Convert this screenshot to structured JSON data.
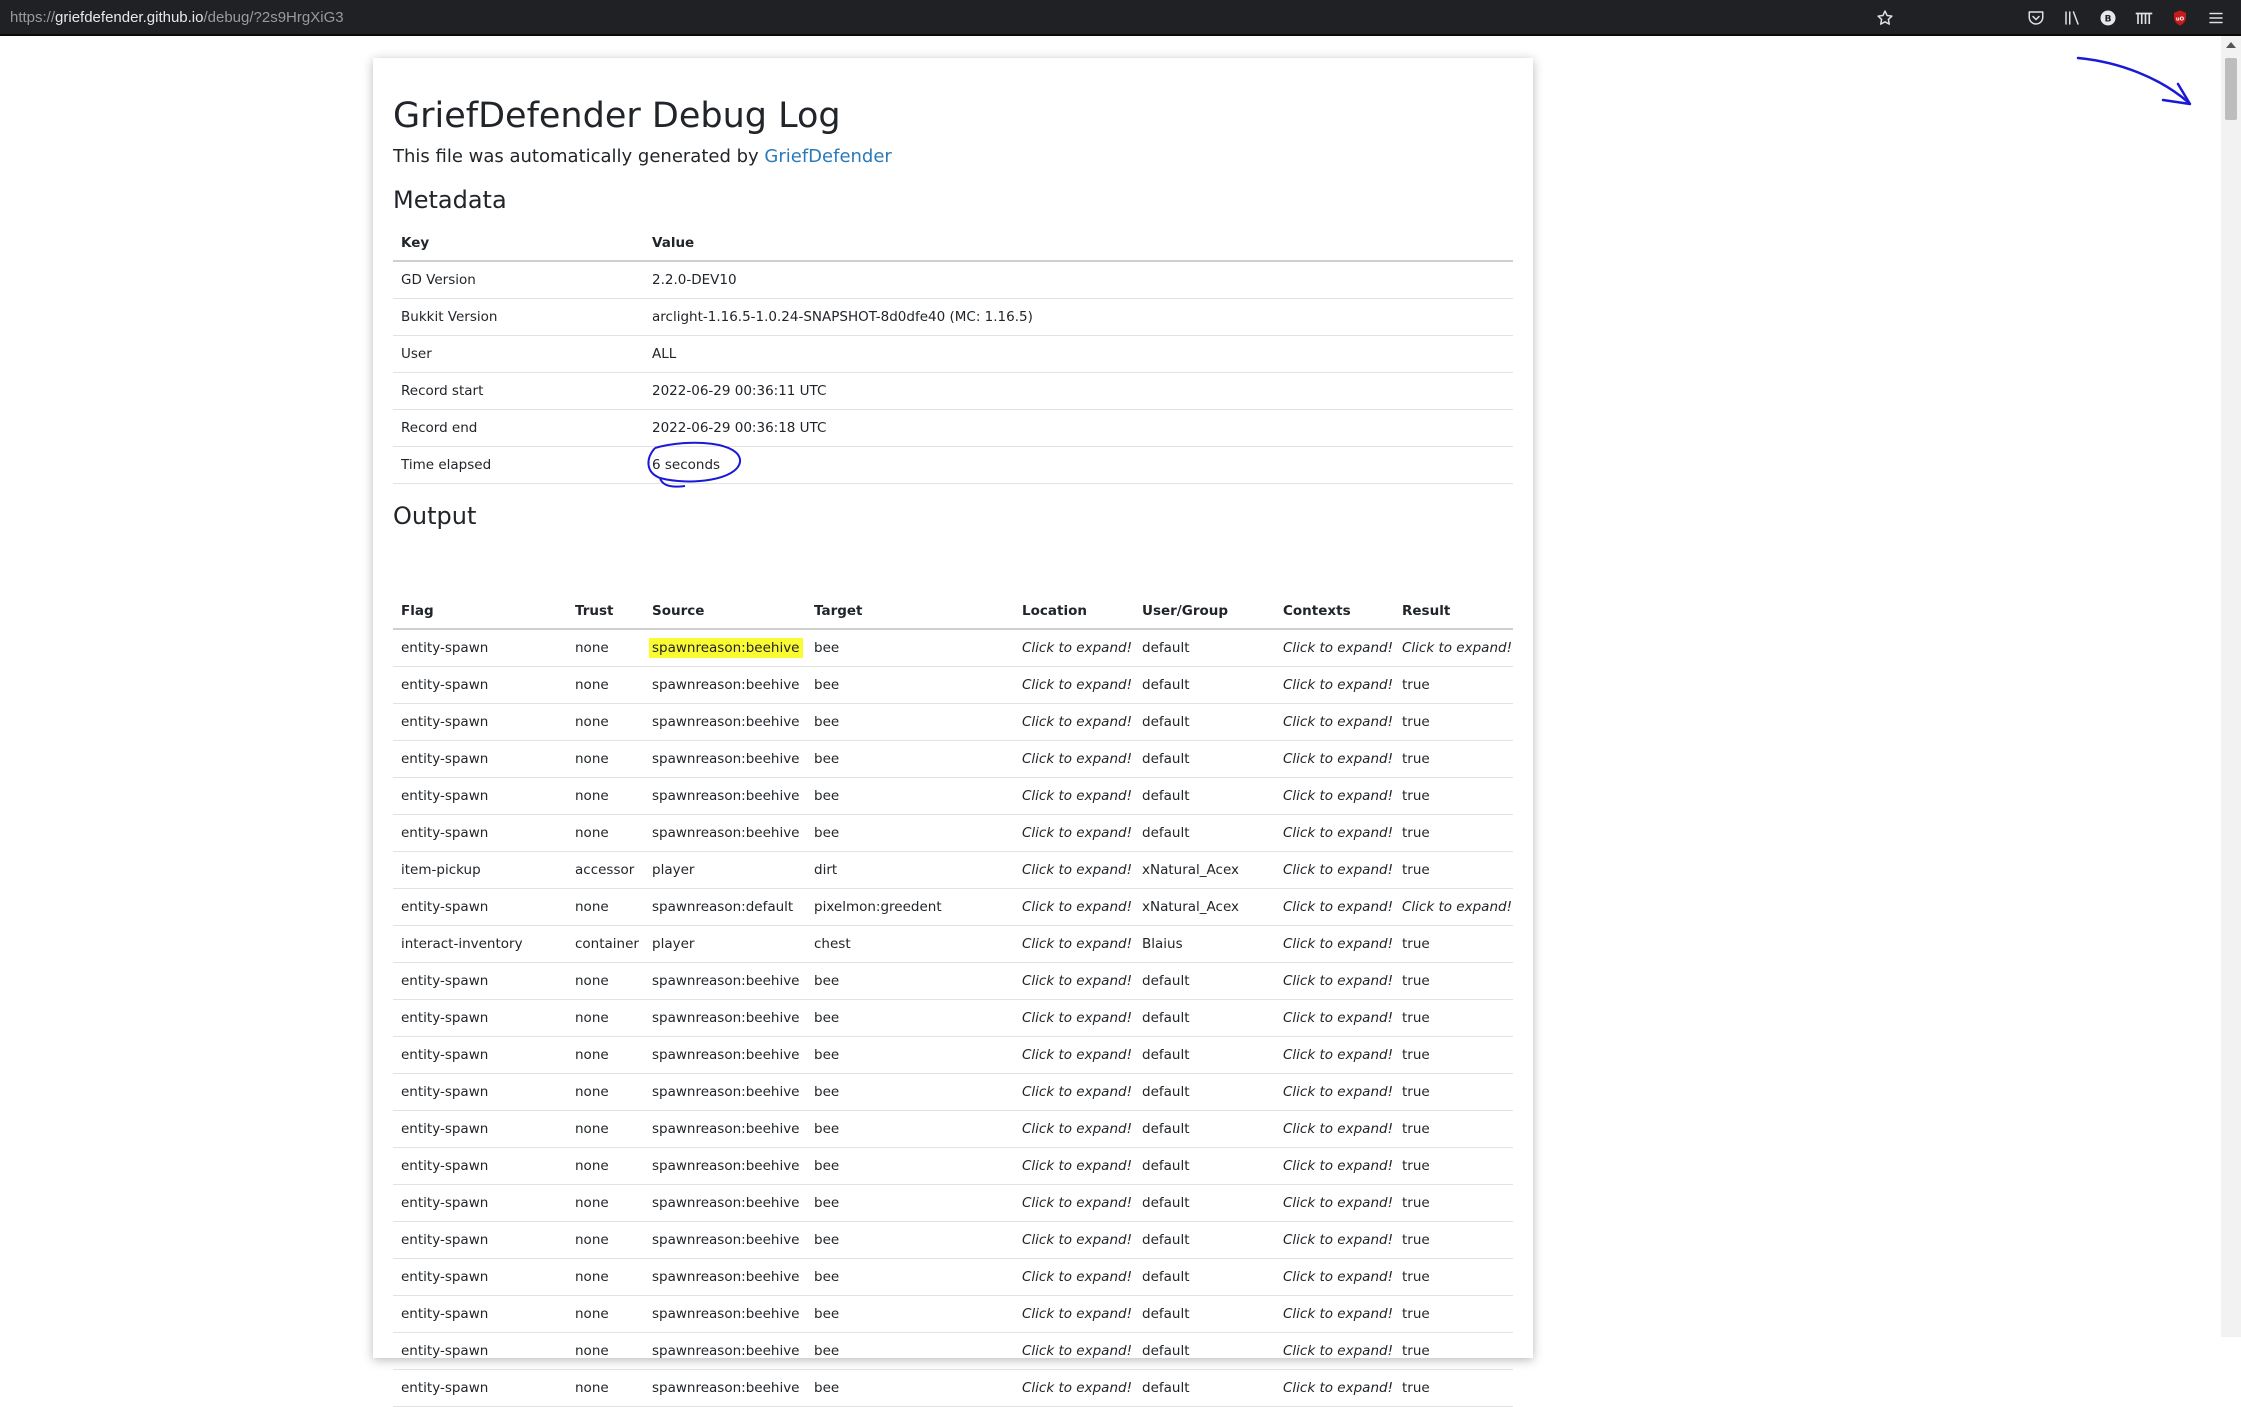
{
  "browser": {
    "url_prefix": "https://",
    "url_host": "griefdefender.github.io",
    "url_path": "/debug/?2s9HrgXiG3"
  },
  "page": {
    "title": "GriefDefender Debug Log",
    "subtitle_text": "This file was automatically generated by ",
    "subtitle_link": "GriefDefender"
  },
  "metadata": {
    "heading": "Metadata",
    "columns": [
      "Key",
      "Value"
    ],
    "rows": [
      [
        "GD Version",
        "2.2.0-DEV10"
      ],
      [
        "Bukkit Version",
        "arclight-1.16.5-1.0.24-SNAPSHOT-8d0dfe40 (MC: 1.16.5)"
      ],
      [
        "User",
        "ALL"
      ],
      [
        "Record start",
        "2022-06-29 00:36:11 UTC"
      ],
      [
        "Record end",
        "2022-06-29 00:36:18 UTC"
      ],
      [
        "Time elapsed",
        "6 seconds"
      ]
    ]
  },
  "output": {
    "heading": "Output",
    "columns": [
      "Flag",
      "Trust",
      "Source",
      "Target",
      "Location",
      "User/Group",
      "Contexts",
      "Result"
    ],
    "rows": [
      [
        "entity-spawn",
        "none",
        "spawnreason:beehive",
        "bee",
        "Click to expand!",
        "default",
        "Click to expand!",
        "Click to expand!"
      ],
      [
        "entity-spawn",
        "none",
        "spawnreason:beehive",
        "bee",
        "Click to expand!",
        "default",
        "Click to expand!",
        "true"
      ],
      [
        "entity-spawn",
        "none",
        "spawnreason:beehive",
        "bee",
        "Click to expand!",
        "default",
        "Click to expand!",
        "true"
      ],
      [
        "entity-spawn",
        "none",
        "spawnreason:beehive",
        "bee",
        "Click to expand!",
        "default",
        "Click to expand!",
        "true"
      ],
      [
        "entity-spawn",
        "none",
        "spawnreason:beehive",
        "bee",
        "Click to expand!",
        "default",
        "Click to expand!",
        "true"
      ],
      [
        "entity-spawn",
        "none",
        "spawnreason:beehive",
        "bee",
        "Click to expand!",
        "default",
        "Click to expand!",
        "true"
      ],
      [
        "item-pickup",
        "accessor",
        "player",
        "dirt",
        "Click to expand!",
        "xNatural_Acex",
        "Click to expand!",
        "true"
      ],
      [
        "entity-spawn",
        "none",
        "spawnreason:default",
        "pixelmon:greedent",
        "Click to expand!",
        "xNatural_Acex",
        "Click to expand!",
        "Click to expand!"
      ],
      [
        "interact-inventory",
        "container",
        "player",
        "chest",
        "Click to expand!",
        "Blaius",
        "Click to expand!",
        "true"
      ],
      [
        "entity-spawn",
        "none",
        "spawnreason:beehive",
        "bee",
        "Click to expand!",
        "default",
        "Click to expand!",
        "true"
      ],
      [
        "entity-spawn",
        "none",
        "spawnreason:beehive",
        "bee",
        "Click to expand!",
        "default",
        "Click to expand!",
        "true"
      ],
      [
        "entity-spawn",
        "none",
        "spawnreason:beehive",
        "bee",
        "Click to expand!",
        "default",
        "Click to expand!",
        "true"
      ],
      [
        "entity-spawn",
        "none",
        "spawnreason:beehive",
        "bee",
        "Click to expand!",
        "default",
        "Click to expand!",
        "true"
      ],
      [
        "entity-spawn",
        "none",
        "spawnreason:beehive",
        "bee",
        "Click to expand!",
        "default",
        "Click to expand!",
        "true"
      ],
      [
        "entity-spawn",
        "none",
        "spawnreason:beehive",
        "bee",
        "Click to expand!",
        "default",
        "Click to expand!",
        "true"
      ],
      [
        "entity-spawn",
        "none",
        "spawnreason:beehive",
        "bee",
        "Click to expand!",
        "default",
        "Click to expand!",
        "true"
      ],
      [
        "entity-spawn",
        "none",
        "spawnreason:beehive",
        "bee",
        "Click to expand!",
        "default",
        "Click to expand!",
        "true"
      ],
      [
        "entity-spawn",
        "none",
        "spawnreason:beehive",
        "bee",
        "Click to expand!",
        "default",
        "Click to expand!",
        "true"
      ],
      [
        "entity-spawn",
        "none",
        "spawnreason:beehive",
        "bee",
        "Click to expand!",
        "default",
        "Click to expand!",
        "true"
      ],
      [
        "entity-spawn",
        "none",
        "spawnreason:beehive",
        "bee",
        "Click to expand!",
        "default",
        "Click to expand!",
        "true"
      ],
      [
        "entity-spawn",
        "none",
        "spawnreason:beehive",
        "bee",
        "Click to expand!",
        "default",
        "Click to expand!",
        "true"
      ]
    ]
  },
  "icons": {
    "bookmark": "star-outline-icon",
    "pocket": "pocket-icon",
    "library": "library-icon",
    "bitwarden": "bitwarden-shield-icon",
    "bars": "reading-list-icon",
    "ublock": "ublock-origin-icon",
    "menu": "hamburger-menu-icon"
  },
  "colors": {
    "link": "#2a7ab8",
    "highlight": "#fbfb32",
    "annotation_ink": "#1a1ad6",
    "ublock_red": "#c41b1b"
  }
}
